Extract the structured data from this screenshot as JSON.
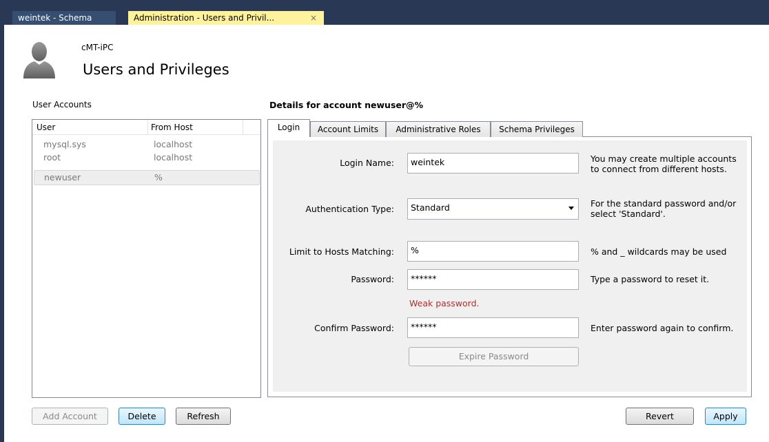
{
  "tabs": {
    "schema": "weintek - Schema",
    "admin": "Administration - Users and Privil...",
    "close": "×"
  },
  "header": {
    "subtitle": "cMT-iPC",
    "title": "Users and Privileges"
  },
  "accounts": {
    "label": "User Accounts",
    "columns": [
      "User",
      "From Host"
    ],
    "rows": [
      {
        "user": "mysql.sys",
        "host": "localhost"
      },
      {
        "user": "root",
        "host": "localhost"
      },
      {
        "user": "newuser",
        "host": "%"
      }
    ],
    "selected_index": 2
  },
  "buttons": {
    "add": "Add Account",
    "delete": "Delete",
    "refresh": "Refresh",
    "revert": "Revert",
    "apply": "Apply"
  },
  "details": {
    "title": "Details for account newuser@%",
    "tabs": [
      "Login",
      "Account Limits",
      "Administrative Roles",
      "Schema Privileges"
    ],
    "active_tab": "Login",
    "login_name": {
      "label": "Login Name:",
      "value": "weintek",
      "help1": "You may create multiple accounts",
      "help2": "to connect from different hosts."
    },
    "auth_type": {
      "label": "Authentication Type:",
      "value": "Standard",
      "help1": "For the standard password and/or",
      "help2": "select 'Standard'."
    },
    "hosts": {
      "label": "Limit to Hosts Matching:",
      "value": "%",
      "help": "% and _ wildcards may be used"
    },
    "password": {
      "label": "Password:",
      "value": "******",
      "help": "Type a password to reset it."
    },
    "warning": "Weak password.",
    "confirm": {
      "label": "Confirm Password:",
      "value": "******",
      "help": "Enter password again to confirm."
    },
    "expire_button": "Expire Password"
  },
  "colors": {
    "titlebar": "#293955",
    "active_tab": "#fff29d",
    "warning": "#a83232"
  }
}
